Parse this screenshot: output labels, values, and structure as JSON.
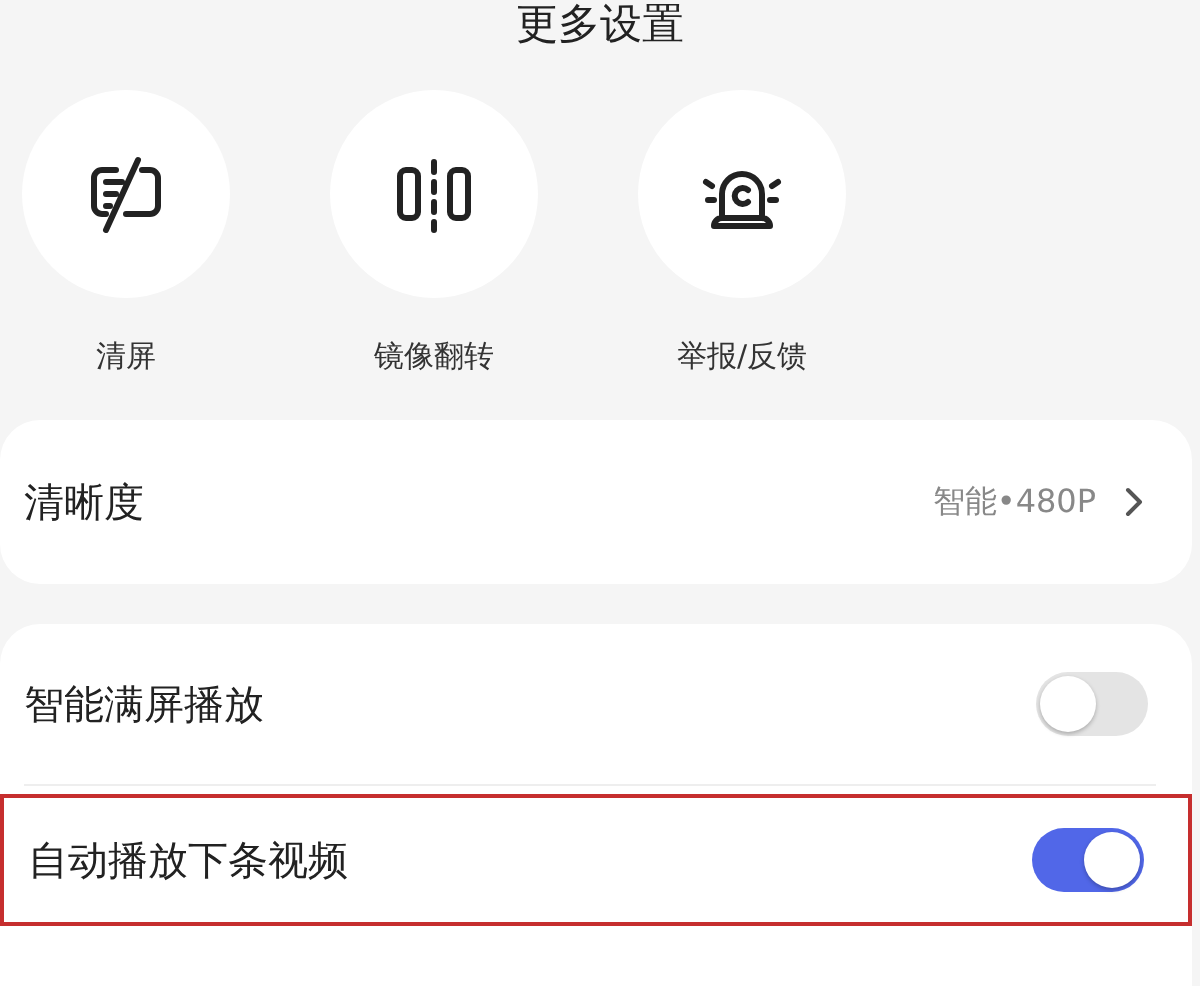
{
  "title": "更多设置",
  "actions": [
    {
      "kind": "clear",
      "label": "清屏"
    },
    {
      "kind": "mirror",
      "label": "镜像翻转"
    },
    {
      "kind": "report",
      "label": "举报/反馈"
    }
  ],
  "quality": {
    "label": "清晰度",
    "value": "智能•480P"
  },
  "toggles": [
    {
      "label": "智能满屏播放",
      "on": false,
      "highlighted": false
    },
    {
      "label": "自动播放下条视频",
      "on": true,
      "highlighted": true
    }
  ]
}
